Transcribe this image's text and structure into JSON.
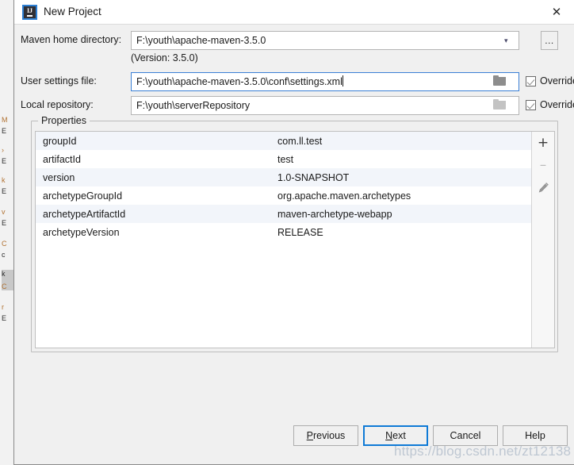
{
  "window": {
    "title": "New Project",
    "app_icon": "intellij-idea-icon",
    "close_label": "✕"
  },
  "form": {
    "maven_home": {
      "label": "Maven home directory:",
      "value": "F:\\youth\\apache-maven-3.5.0",
      "dropdown_icon": "chevron-down-icon",
      "browse_label": "...",
      "version_note": "(Version: 3.5.0)"
    },
    "user_settings": {
      "label": "User settings file:",
      "value": "F:\\youth\\apache-maven-3.5.0\\conf\\settings.xml",
      "folder_icon": "folder-icon",
      "override_label": "Override",
      "override_checked": true,
      "focused": true
    },
    "local_repository": {
      "label": "Local repository:",
      "value": "F:\\youth\\serverRepository",
      "folder_icon": "folder-icon",
      "override_label": "Override",
      "override_checked": true,
      "focused": false
    }
  },
  "properties": {
    "legend": "Properties",
    "rows": [
      {
        "key": "groupId",
        "value": "com.ll.test"
      },
      {
        "key": "artifactId",
        "value": "test"
      },
      {
        "key": "version",
        "value": "1.0-SNAPSHOT"
      },
      {
        "key": "archetypeGroupId",
        "value": "org.apache.maven.archetypes"
      },
      {
        "key": "archetypeArtifactId",
        "value": "maven-archetype-webapp"
      },
      {
        "key": "archetypeVersion",
        "value": "RELEASE"
      }
    ],
    "toolbar": {
      "add": "+",
      "remove": "–",
      "edit_icon": "pencil-icon"
    }
  },
  "footer": {
    "previous": {
      "prefix": "",
      "mnemonic": "P",
      "suffix": "revious"
    },
    "next": {
      "prefix": "",
      "mnemonic": "N",
      "suffix": "ext"
    },
    "cancel": {
      "label": "Cancel"
    },
    "help": {
      "label": "Help"
    }
  },
  "watermark": "https://blog.csdn.net/zt12138",
  "colors": {
    "focus_blue": "#3a7fd5",
    "default_button_blue": "#0f7ad6",
    "row_alt": "#f2f5fa",
    "dialog_bg": "#f0f0f0"
  },
  "background_window": {
    "strips": [
      "Λ",
      "│",
      "┃",
      "┑",
      "│",
      "┃",
      "┑",
      "│",
      "┃"
    ]
  }
}
